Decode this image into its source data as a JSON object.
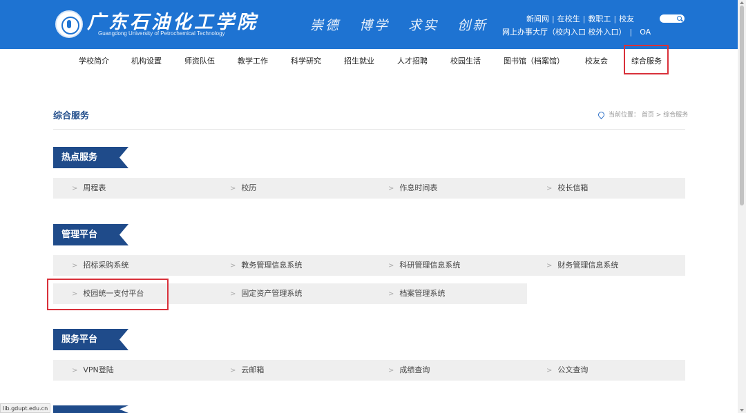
{
  "header": {
    "school_name_cn": "广东石油化工学院",
    "school_name_en": "Guangdong University of Petrochemical Technology",
    "motto": [
      "崇德",
      "博学",
      "求实",
      "创新"
    ],
    "top_links_row1": [
      "新闻网",
      "在校生",
      "教职工",
      "校友"
    ],
    "top_links_row2": [
      "网上办事大厅（校内入口",
      "校外入口）",
      "OA"
    ]
  },
  "nav": {
    "items": [
      "学校简介",
      "机构设置",
      "师资队伍",
      "教学工作",
      "科学研究",
      "招生就业",
      "人才招聘",
      "校园生活",
      "图书馆（档案馆）",
      "校友会",
      "综合服务"
    ],
    "active": "综合服务"
  },
  "page": {
    "title": "综合服务",
    "breadcrumb_prefix": "当前位置：",
    "breadcrumb": [
      "首页",
      "综合服务"
    ],
    "breadcrumb_sep": ">"
  },
  "sections": [
    {
      "title": "热点服务",
      "rows": [
        [
          "周程表",
          "校历",
          "作息时间表",
          "校长信箱"
        ]
      ]
    },
    {
      "title": "管理平台",
      "rows": [
        [
          "招标采购系统",
          "教务管理信息系统",
          "科研管理信息系统",
          "财务管理信息系统"
        ],
        [
          "校园统一支付平台",
          "固定资产管理系统",
          "档案管理系统"
        ]
      ]
    },
    {
      "title": "服务平台",
      "rows": [
        [
          "VPN登陆",
          "云邮箱",
          "成绩查询",
          "公文查询"
        ]
      ]
    }
  ],
  "status_bar_url": "lib.gdupt.edu.cn",
  "colors": {
    "header_blue": "#1e73d2",
    "section_navy": "#1f4b8a",
    "highlight_red": "#d9303a",
    "row_gray": "#efefef"
  }
}
